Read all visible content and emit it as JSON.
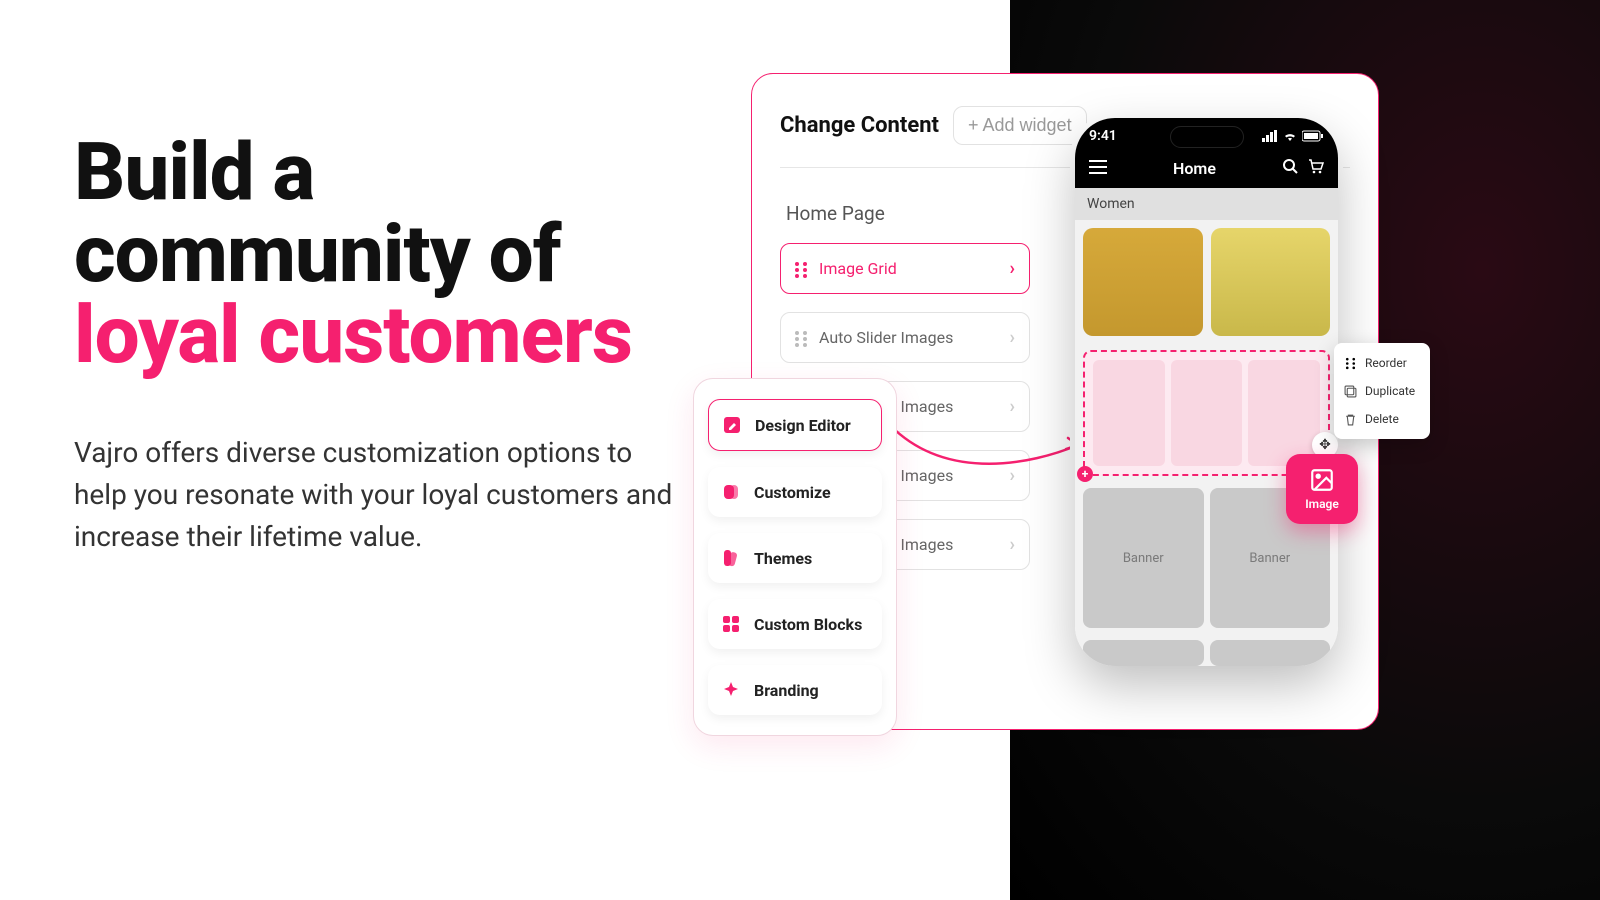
{
  "hero": {
    "line1": "Build a",
    "line2": "community of",
    "line3": "loyal customers",
    "body": "Vajro offers diverse customization options to help you resonate with your loyal customers and increase their lifetime value."
  },
  "editor": {
    "title": "Change Content",
    "add_widget": "+ Add widget",
    "section": "Home Page",
    "widgets": [
      {
        "label": "Image Grid",
        "active": true
      },
      {
        "label": "Auto Slider Images",
        "active": false
      },
      {
        "label": "Auto Slider Images",
        "active": false
      },
      {
        "label": "Auto Slider Images",
        "active": false
      },
      {
        "label": "Auto Slider Images",
        "active": false
      }
    ]
  },
  "menu": {
    "items": [
      {
        "label": "Design Editor",
        "active": true,
        "icon": "pencil-square-icon"
      },
      {
        "label": "Customize",
        "active": false,
        "icon": "palette-icon"
      },
      {
        "label": "Themes",
        "active": false,
        "icon": "swatch-icon"
      },
      {
        "label": "Custom Blocks",
        "active": false,
        "icon": "grid-icon"
      },
      {
        "label": "Branding",
        "active": false,
        "icon": "sparkle-icon"
      }
    ]
  },
  "phone": {
    "time": "9:41",
    "screen_title": "Home",
    "category": "Women",
    "banner_label": "Banner"
  },
  "ctx": {
    "reorder": "Reorder",
    "duplicate": "Duplicate",
    "delete": "Delete"
  },
  "float_btn": {
    "label": "Image"
  },
  "colors": {
    "accent": "#f5206f"
  }
}
